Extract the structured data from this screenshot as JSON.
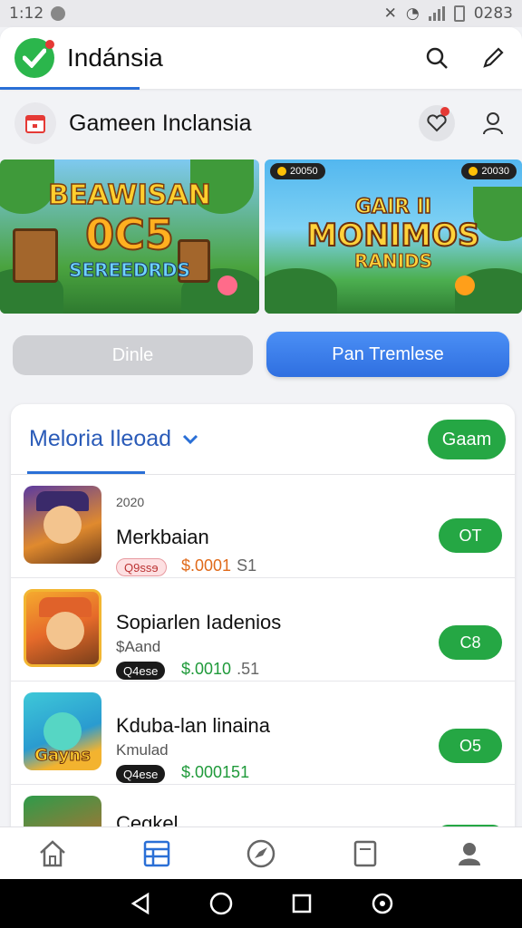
{
  "status_bar": {
    "time": "1:12",
    "right_text": "0283"
  },
  "app_bar": {
    "title": "Indánsia",
    "logo_icon": "check-logo-icon",
    "actions": [
      "search-icon",
      "edit-pencil-icon"
    ]
  },
  "sub_header": {
    "title": "Gameen Inclansia",
    "left_icon": "calendar-icon",
    "actions": [
      "heart-icon",
      "profile-outline-icon"
    ]
  },
  "banners": [
    {
      "line1": "BEAWISAN",
      "line2": "0C5",
      "line3": "SEREEDRDS"
    },
    {
      "pill_left": "20050",
      "pill_right": "20030",
      "line1": "GAIR II",
      "line2": "MONIMOS",
      "line3": "RANIDS"
    }
  ],
  "buttons": {
    "secondary": "Dinle",
    "primary": "Pan Tremlese"
  },
  "list_card": {
    "title": "Meloria Ileoad",
    "filter_button": "Gaam",
    "items": [
      {
        "meta": "2020",
        "name": "Merkbaian",
        "badge": "Q9ssɘ",
        "badge_style": "red",
        "price": "$.0001",
        "price_tail": "S1",
        "price_style": "orange",
        "action": "OT",
        "thumb_label": ""
      },
      {
        "meta": "",
        "name": "Sopiarlen Iadenios",
        "sub": "$Aand",
        "badge": "Q4ese",
        "badge_style": "black",
        "price": "$.0010",
        "price_tail": ".51",
        "price_style": "green",
        "action": "C8",
        "thumb_label": ""
      },
      {
        "meta": "",
        "name": "Kduba-lan linaina",
        "sub": "Kmulad",
        "badge": "Q4ese",
        "badge_style": "black",
        "price": "$.000151",
        "price_tail": "",
        "price_style": "green",
        "action": "O5",
        "thumb_label": "Gayns"
      },
      {
        "name": "Cegkel"
      }
    ]
  },
  "bottom_nav": [
    "home-icon",
    "grid-list-icon",
    "compass-icon",
    "document-icon",
    "account-icon"
  ],
  "system_nav": [
    "back-icon",
    "home-circle-icon",
    "recents-icon",
    "assistant-icon"
  ],
  "colors": {
    "accent_blue": "#2a6fd6",
    "green": "#25a744",
    "title_blue": "#2a5bb8"
  }
}
